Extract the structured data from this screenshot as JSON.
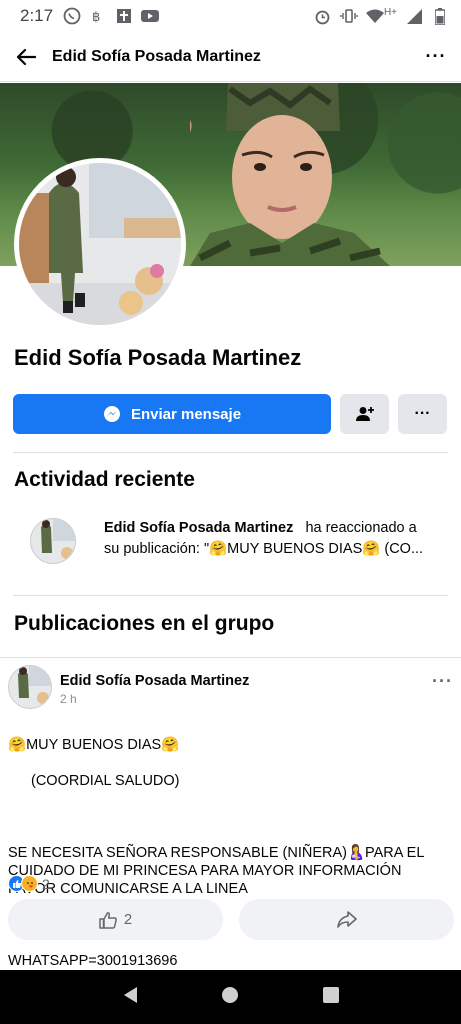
{
  "status_bar": {
    "time": "2:17",
    "network_label": "H+"
  },
  "app_bar": {
    "title": "Edid Sofía Posada Martinez",
    "more_label": "···"
  },
  "profile": {
    "name": "Edid Sofía Posada Martinez",
    "message_button": "Enviar mensaje",
    "more_label": "···"
  },
  "recent_activity": {
    "heading": "Actividad reciente",
    "name": "Edid Sofía Posada Martinez",
    "text_part1": "ha reaccionado a su publicación: \"",
    "text_part2": "MUY BUENOS DIAS",
    "text_part3": " (CO..."
  },
  "group_posts": {
    "heading": "Publicaciones en el grupo",
    "post": {
      "author": "Edid Sofía Posada Martinez",
      "time": "2 h",
      "more_label": "···",
      "line1": "MUY BUENOS DIAS",
      "line2": "(COORDIAL SALUDO)",
      "para1_a": "SE NECESITA SEÑORA RESPONSABLE (NIÑERA)",
      "para1_b": "PARA EL CUIDADO DE MI PRINCESA PARA MAYOR INFORMACIÓN FAVOR COMUNICARSE A LA LINEA",
      "para2": "WHATSAPP=3001913696",
      "reaction_count": "2",
      "like_count": "2"
    }
  },
  "colors": {
    "brand": "#1877f2",
    "secondary_button": "#e4e6eb",
    "action_bg": "#f0f2f5"
  }
}
